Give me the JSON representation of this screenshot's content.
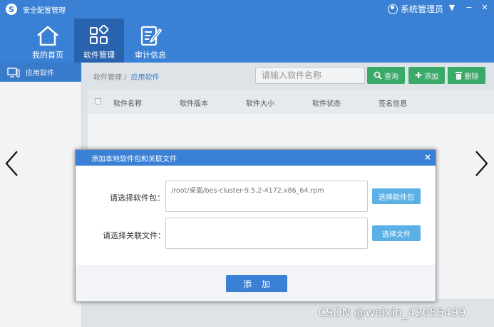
{
  "app": {
    "title": "安全配置管理",
    "logo_glyph": "S",
    "user_name": "系统管理员",
    "window_controls": [
      "▼",
      "−",
      "✕"
    ]
  },
  "nav": {
    "tabs": [
      {
        "label": "我的首页",
        "icon": "home-icon",
        "active": false
      },
      {
        "label": "软件管理",
        "icon": "grid-icon",
        "active": true
      },
      {
        "label": "审计信息",
        "icon": "edit-document-icon",
        "active": false
      }
    ]
  },
  "sidebar": {
    "items": [
      {
        "label": "应用软件",
        "icon": "monitor-icon",
        "active": true
      }
    ]
  },
  "main": {
    "breadcrumb": {
      "parent": "软件管理 /",
      "current": "应用软件"
    },
    "search_placeholder": "请输入软件名称",
    "buttons": {
      "search": {
        "icon": "search-icon",
        "label": "查询"
      },
      "add": {
        "icon": "plus-icon",
        "label": "添加"
      },
      "delete": {
        "icon": "trash-icon",
        "label": "删除"
      }
    },
    "columns": [
      "软件名称",
      "软件版本",
      "软件大小",
      "软件状态",
      "签名信息"
    ]
  },
  "modal": {
    "title": "添加本地软件包和关联文件",
    "close": "×",
    "package_label": "请选择软件包：",
    "package_value": "/root/桌面/bes-cluster-9.5.2-4172.x86_64.rpm",
    "package_button": "选择软件包",
    "file_label": "请选择关联文件：",
    "file_value": "",
    "file_button": "选择文件",
    "submit": "添加"
  },
  "watermark": "CSDN @weixin_42055499",
  "colors": {
    "primary": "#3a80d4",
    "primary_dark": "#2a63ad",
    "success": "#3db16b",
    "light_button": "#5bb1e6"
  }
}
